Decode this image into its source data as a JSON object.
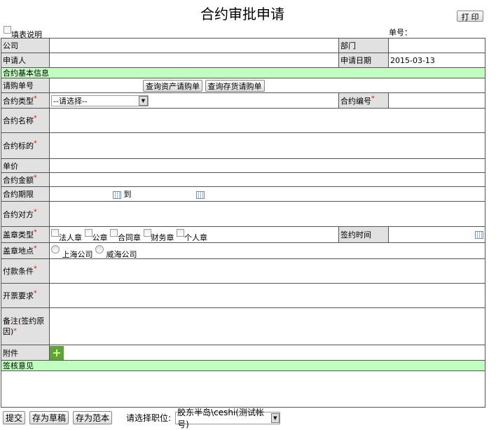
{
  "title": "合约审批申请",
  "print_label": "打 印",
  "instructions_label": "填表说明",
  "serial_label": "单号：",
  "rows": {
    "company": "公司",
    "department": "部门",
    "applicant": "申请人",
    "apply_date_label": "申请日期",
    "apply_date": "2015-03-13",
    "section_basic": "合约基本信息",
    "purchase_no": "请购单号",
    "query_asset": "查询资产请购单",
    "query_stock": "查询存货请购单",
    "contract_type": "合约类型",
    "contract_type_value": "--请选择--",
    "contract_no": "合约编号",
    "contract_name": "合约名称",
    "contract_subject": "合约标的",
    "unit_price": "单价",
    "amount": "合约金额",
    "period": "合约期限",
    "period_to": "到",
    "counterparty": "合约对方",
    "seal_type": "盖章类型",
    "seal_options": [
      "法人章",
      "公章",
      "合同章",
      "财务章",
      "个人章"
    ],
    "sign_time": "签约时间",
    "seal_place": "盖章地点",
    "place_options": [
      "上海公司",
      "威海公司"
    ],
    "payment": "付款条件",
    "invoice": "开票要求",
    "remark_line1": "备注(签约原",
    "remark_line2": "因)",
    "attachment": "附件",
    "section_review": "签核意见",
    "required_mark": "*"
  },
  "footer": {
    "submit": "提交",
    "draft": "存为草稿",
    "template": "存为范本",
    "position_label": "请选择职位:",
    "position_value": "胶东半岛\\ceshi(测试帐号)"
  }
}
